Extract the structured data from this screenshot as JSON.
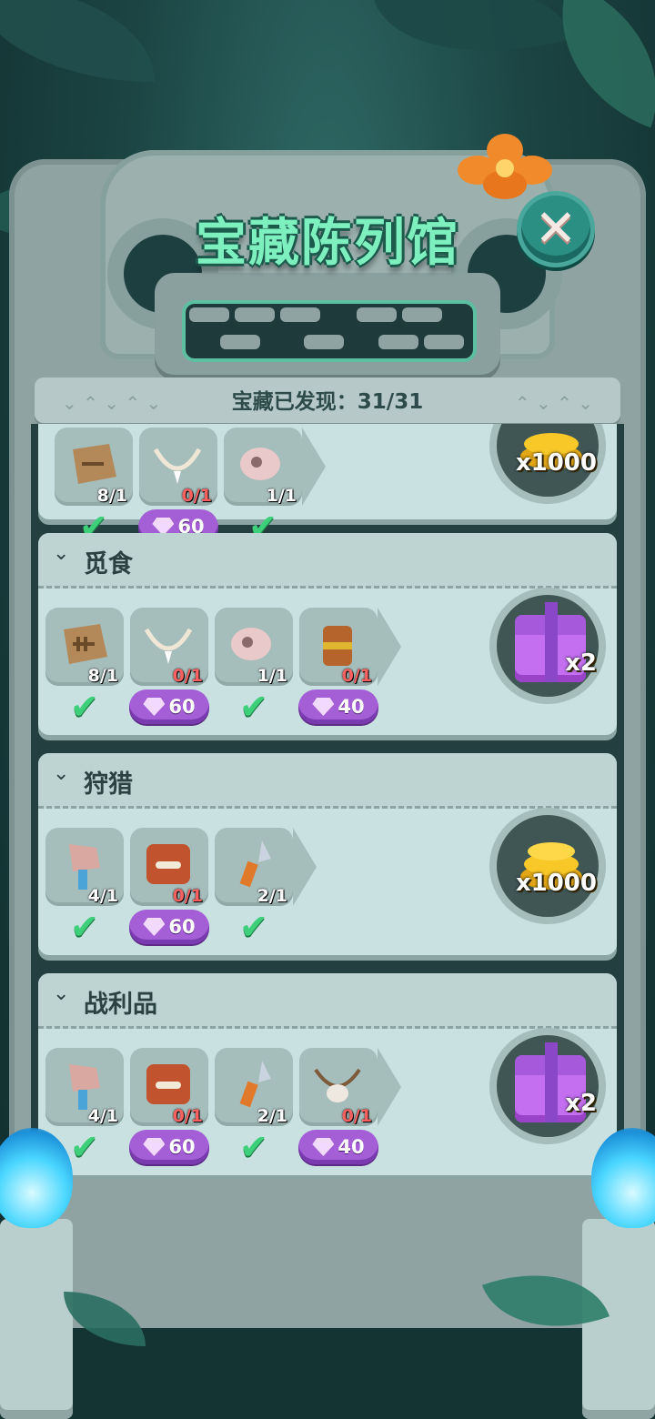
{
  "title": "宝藏陈列馆",
  "close_label": "✕",
  "discovered_label": "宝藏已发现：31/31",
  "categories": [
    {
      "name": "",
      "items": [
        {
          "icon": "fossil-fish-icon",
          "count": "8/1",
          "status": "check"
        },
        {
          "icon": "tooth-necklace-icon",
          "count": "0/1",
          "status": "gem",
          "gem_cost": "60"
        },
        {
          "icon": "bird-skull-icon",
          "count": "1/1",
          "status": "check"
        }
      ],
      "reward": {
        "icon": "gold-coins-icon",
        "amount": "x1000"
      }
    },
    {
      "name": "觅食",
      "items": [
        {
          "icon": "fossil-fish-icon",
          "count": "8/1",
          "status": "check"
        },
        {
          "icon": "tooth-necklace-icon",
          "count": "0/1",
          "status": "gem",
          "gem_cost": "60"
        },
        {
          "icon": "bird-skull-icon",
          "count": "1/1",
          "status": "check"
        },
        {
          "icon": "wood-drum-icon",
          "count": "0/1",
          "status": "gem",
          "gem_cost": "40"
        }
      ],
      "reward": {
        "icon": "purple-gift-icon",
        "amount": "x2"
      }
    },
    {
      "name": "狩猎",
      "items": [
        {
          "icon": "stone-hammer-icon",
          "count": "4/1",
          "status": "check"
        },
        {
          "icon": "bone-slab-icon",
          "count": "0/1",
          "status": "gem",
          "gem_cost": "60"
        },
        {
          "icon": "stone-spear-icon",
          "count": "2/1",
          "status": "check"
        }
      ],
      "reward": {
        "icon": "gold-coins-icon",
        "amount": "x1000"
      }
    },
    {
      "name": "战利品",
      "items": [
        {
          "icon": "stone-hammer-icon",
          "count": "4/1",
          "status": "check"
        },
        {
          "icon": "bone-slab-icon",
          "count": "0/1",
          "status": "gem",
          "gem_cost": "60"
        },
        {
          "icon": "stone-spear-icon",
          "count": "2/1",
          "status": "check"
        },
        {
          "icon": "skull-necklace-icon",
          "count": "0/1",
          "status": "gem",
          "gem_cost": "40"
        }
      ],
      "reward": {
        "icon": "purple-gift-icon",
        "amount": "x2"
      }
    }
  ],
  "colors": {
    "title": "#7ef0c0",
    "check": "#3ecf7a",
    "gem_button": "#a45fd6",
    "card": "#c9e2e1"
  }
}
